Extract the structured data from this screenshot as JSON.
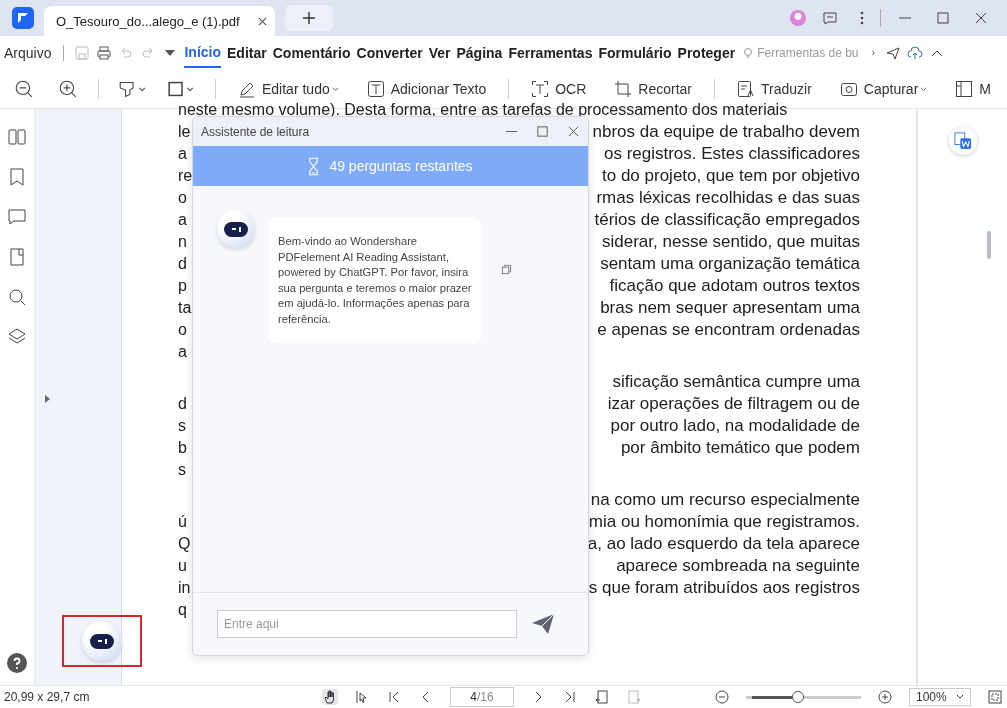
{
  "tabs": [
    {
      "label": "O_Tesouro_do...alego_e (1).pdf",
      "selected": true
    }
  ],
  "menu": {
    "file": "Arquivo",
    "items": [
      {
        "label": "Início",
        "selected": true
      },
      {
        "label": "Editar",
        "selected": false
      },
      {
        "label": "Comentário",
        "selected": false
      },
      {
        "label": "Converter",
        "selected": false
      },
      {
        "label": "Ver",
        "selected": false
      },
      {
        "label": "Página",
        "selected": false
      },
      {
        "label": "Ferramentas",
        "selected": false
      },
      {
        "label": "Formulário",
        "selected": false
      },
      {
        "label": "Proteger",
        "selected": false
      }
    ],
    "search_placeholder": "Ferramentas de bu"
  },
  "toolbar": [
    {
      "kind": "edit",
      "label": "Editar tudo",
      "dropdown": true
    },
    {
      "kind": "text",
      "label": "Adicionar Texto",
      "dropdown": false
    },
    {
      "kind": "ocr",
      "label": "OCR",
      "dropdown": false
    },
    {
      "kind": "crop",
      "label": "Recortar",
      "dropdown": false
    },
    {
      "kind": "translate",
      "label": "Traduzir",
      "dropdown": false
    },
    {
      "kind": "capture",
      "label": "Capturar",
      "dropdown": true
    },
    {
      "kind": "more",
      "label": "M",
      "dropdown": false
    }
  ],
  "document": {
    "paragraphs": [
      {
        "lines": [
          {
            "left": "neste mesmo volume). Desta forma, entre as tarefas de processamento dos materiais"
          },
          {
            "left": "le",
            "right": "nbros da equipe de trabalho devem"
          },
          {
            "left": "a",
            "right": "os registros. Estes classificadores"
          },
          {
            "left": "re",
            "right": "to do projeto, que tem por objetivo"
          },
          {
            "left": "o",
            "right": "rmas léxicas recolhidas e das suas"
          },
          {
            "left": "a",
            "right": "térios de classificação empregados"
          },
          {
            "left": "n",
            "right": "siderar, nesse sentido, que muitas"
          },
          {
            "left": "d",
            "right": "sentam uma organização temática"
          },
          {
            "left": "p",
            "right": "ficação que adotam outros textos"
          },
          {
            "left": "ta",
            "right": "bras nem sequer apresentam uma"
          },
          {
            "left": "o",
            "right": "e apenas se encontram ordenadas"
          },
          {
            "left": "a"
          }
        ]
      },
      {
        "lines": [
          {
            "right": "sificação semântica cumpre uma"
          },
          {
            "left": "d",
            "right": "izar operações de filtragem ou de"
          },
          {
            "left": "s",
            "right": "por outro lado, na modalidade de"
          },
          {
            "left": "b",
            "right": "por âmbito temático que podem"
          },
          {
            "left": "s"
          }
        ]
      },
      {
        "lines": [
          {
            "right": "na como um recurso especialmente"
          },
          {
            "left": "ú",
            "right": "mia ou homonímia que registramos."
          },
          {
            "left": "Q",
            "right": "a, ao lado esquerdo da tela aparece"
          },
          {
            "left": "u",
            "right": "aparece sombreada na seguinte"
          },
          {
            "left": "in",
            "right": "s que foram atribuídos aos registros"
          },
          {
            "left": "q"
          }
        ]
      }
    ]
  },
  "assistant": {
    "title": "Assistente de leitura",
    "remaining": "49 perguntas restantes",
    "message": "Bem-vindo ao Wondershare PDFelement AI Reading Assistant, powered by ChatGPT. Por favor, insira sua pergunta e teremos o maior prazer em ajudá-lo. Informações apenas para referência.",
    "placeholder": "Entre aqui"
  },
  "status_bar": {
    "size": "20,99 x 29,7 cm",
    "page": "4",
    "total": "/16",
    "zoom": {
      "level": 0.39,
      "value": "100%"
    }
  }
}
